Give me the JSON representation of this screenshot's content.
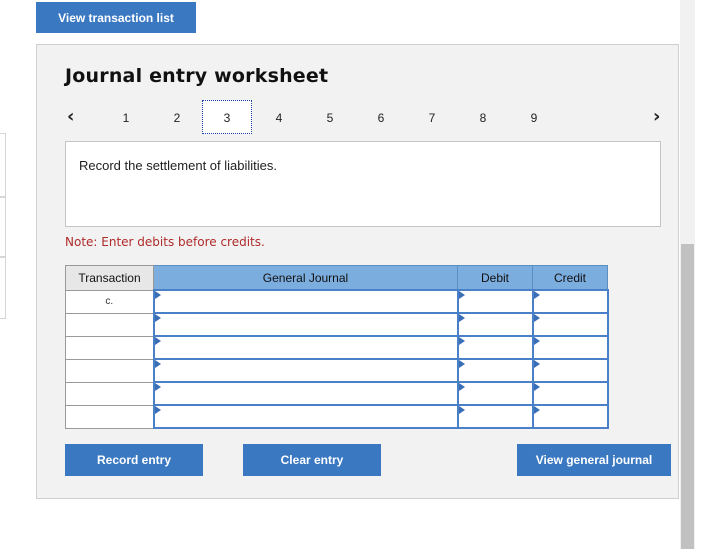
{
  "top": {
    "view_transaction_list": "View transaction list"
  },
  "worksheet": {
    "title": "Journal entry worksheet",
    "nav": {
      "prev_icon": "chevron-left-icon",
      "next_icon": "chevron-right-icon",
      "steps": [
        "1",
        "2",
        "3",
        "4",
        "5",
        "6",
        "7",
        "8",
        "9"
      ],
      "active_step": "3"
    },
    "instruction": "Record the settlement of liabilities.",
    "note": "Note: Enter debits before credits.",
    "table": {
      "headers": {
        "transaction": "Transaction",
        "general_journal": "General Journal",
        "debit": "Debit",
        "credit": "Credit"
      },
      "rows": [
        {
          "transaction": "c."
        },
        {
          "transaction": ""
        },
        {
          "transaction": ""
        },
        {
          "transaction": ""
        },
        {
          "transaction": ""
        },
        {
          "transaction": ""
        }
      ]
    },
    "buttons": {
      "record_entry": "Record entry",
      "clear_entry": "Clear entry",
      "view_general_journal": "View general journal"
    }
  },
  "colors": {
    "accent": "#3a78c2",
    "header_blue": "#7badde",
    "note_red": "#b02a2a"
  }
}
